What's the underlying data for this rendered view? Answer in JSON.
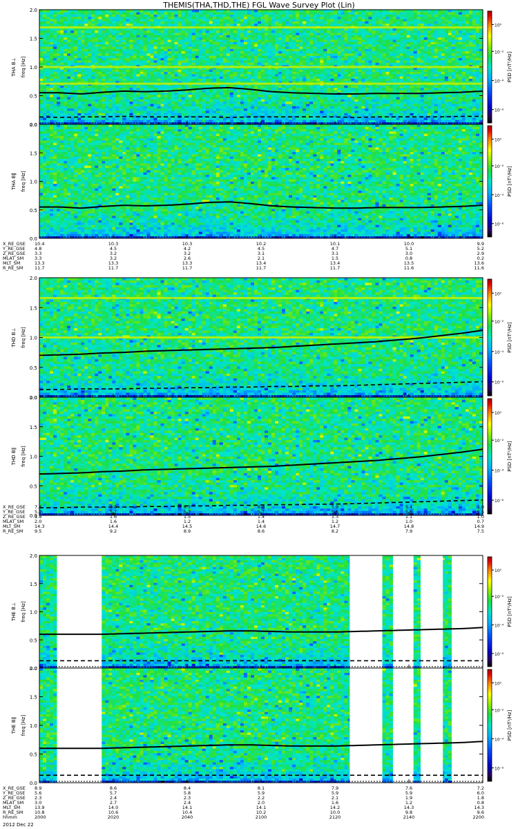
{
  "title": "THEMIS(THA,THD,THE) FGL Wave Survey Plot (Lin)",
  "date_label": "2012 Dec 22",
  "colorbar_label": "PSD [nT²/Hz]",
  "colorbar_ticks": [
    "10⁰",
    "10⁻²",
    "10⁻⁴",
    "10⁻⁶"
  ],
  "ytick_labels": [
    "2.0",
    "1.5",
    "1.0",
    "0.5",
    "0.0"
  ],
  "ephem_labels": [
    "X_RE_GSE",
    "Y_RE_GSE",
    "Z_RE_GSE",
    "MLAT_SM",
    "MLT_SM",
    "R_RE_SM"
  ],
  "ephem_labels_last": [
    "X_RE_GSE",
    "Y_RE_GSE",
    "Z_RE_GSE",
    "MLAT_SM",
    "MLT_SM",
    "R_RE_SM",
    "hhmm"
  ],
  "ephem": {
    "tha": [
      [
        "10.4",
        "10.3",
        "10.3",
        "10.2",
        "10.1",
        "10.0",
        "9.9"
      ],
      [
        "4.8",
        "4.5",
        "4.2",
        "4.5",
        "4.7",
        "5.1",
        "5.2"
      ],
      [
        "3.3",
        "3.2",
        "3.2",
        "3.1",
        "3.1",
        "3.0",
        "2.9"
      ],
      [
        "3.3",
        "3.2",
        "2.6",
        "2.1",
        "1.5",
        "0.8",
        "0.2"
      ],
      [
        "13.3",
        "13.3",
        "13.3",
        "13.4",
        "13.4",
        "13.5",
        "13.6"
      ],
      [
        "11.7",
        "11.7",
        "11.7",
        "11.7",
        "11.7",
        "11.6",
        "11.6"
      ]
    ],
    "thd": [
      [
        "7.4",
        "7.0",
        "6.7",
        "6.3",
        "5.9",
        "5.4",
        "5.0"
      ],
      [
        "5.7",
        "5.7",
        "5.7",
        "5.7",
        "5.6",
        "5.6",
        "5.5"
      ],
      [
        "1.8",
        "1.6",
        "1.5",
        "1.4",
        "1.3",
        "1.1",
        "1.0"
      ],
      [
        "2.0",
        "1.6",
        "1.2",
        "1.4",
        "1.2",
        "1.0",
        "0.7"
      ],
      [
        "14.3",
        "14.4",
        "14.5",
        "14.6",
        "14.7",
        "14.8",
        "14.9"
      ],
      [
        "9.5",
        "9.2",
        "8.9",
        "8.6",
        "8.2",
        "7.9",
        "7.5"
      ]
    ],
    "the": [
      [
        "8.9",
        "8.6",
        "8.4",
        "8.1",
        "7.9",
        "7.6",
        "7.2"
      ],
      [
        "5.6",
        "5.7",
        "5.8",
        "5.9",
        "5.9",
        "5.9",
        "6.0"
      ],
      [
        "2.3",
        "2.4",
        "2.3",
        "2.2",
        "2.1",
        "1.9",
        "1.8"
      ],
      [
        "3.0",
        "2.7",
        "2.4",
        "2.0",
        "1.6",
        "1.2",
        "0.8"
      ],
      [
        "13.9",
        "14.0",
        "14.1",
        "14.1",
        "14.2",
        "14.3",
        "14.3"
      ],
      [
        "10.8",
        "10.6",
        "10.4",
        "10.2",
        "10.0",
        "9.8",
        "9.6"
      ],
      [
        "2000",
        "2020",
        "2040",
        "2100",
        "2120",
        "2140",
        "2200"
      ]
    ]
  },
  "colors": {
    "background": "#ffffff",
    "axis": "#000000",
    "gap": "#ffffff"
  },
  "chart_data": {
    "type": "heatmap",
    "title": "THEMIS(THA,THD,THE) FGL Wave Survey Plot (Lin)",
    "xlabel": "hhmm",
    "x_ticks": [
      "2000",
      "2020",
      "2040",
      "2100",
      "2120",
      "2140",
      "2200"
    ],
    "ylim": [
      0,
      2.0
    ],
    "colorbar": {
      "label": "PSD [nT²/Hz]",
      "scale": "log",
      "range": [
        1e-06,
        10.0
      ],
      "colormap": "rainbow"
    },
    "grid": false,
    "panels": [
      {
        "label": "THA B⊥",
        "ylabel": "freq [Hz]",
        "line_solid": [
          0.55,
          0.55,
          0.53,
          0.56,
          0.58,
          0.57,
          0.58,
          0.6,
          0.63,
          0.64,
          0.61,
          0.57,
          0.55,
          0.54,
          0.53,
          0.53,
          0.54,
          0.54,
          0.54,
          0.55,
          0.56,
          0.58
        ],
        "line_dashed": [
          0.13,
          0.12,
          0.13,
          0.13,
          0.14,
          0.13,
          0.13,
          0.13,
          0.13,
          0.12,
          0.13,
          0.13,
          0.13,
          0.13,
          0.13,
          0.12,
          0.13,
          0.13,
          0.13,
          0.13,
          0.14,
          0.14
        ],
        "bands": [
          1.69,
          1.0,
          0.71
        ],
        "gaps": []
      },
      {
        "label": "THA B∥",
        "ylabel": "freq [Hz]",
        "line_solid": [
          0.55,
          0.55,
          0.53,
          0.56,
          0.58,
          0.57,
          0.58,
          0.6,
          0.63,
          0.64,
          0.61,
          0.57,
          0.55,
          0.54,
          0.53,
          0.53,
          0.54,
          0.54,
          0.54,
          0.55,
          0.56,
          0.58
        ],
        "line_dashed": [],
        "bands": [],
        "gaps": []
      },
      {
        "label": "THD B⊥",
        "ylabel": "freq [Hz]",
        "line_solid": [
          0.7,
          0.71,
          0.72,
          0.74,
          0.75,
          0.77,
          0.78,
          0.79,
          0.8,
          0.81,
          0.82,
          0.83,
          0.85,
          0.87,
          0.89,
          0.91,
          0.93,
          0.96,
          0.99,
          1.03,
          1.07,
          1.12
        ],
        "line_dashed": [
          0.13,
          0.13,
          0.14,
          0.14,
          0.14,
          0.15,
          0.15,
          0.16,
          0.16,
          0.17,
          0.17,
          0.18,
          0.18,
          0.19,
          0.19,
          0.2,
          0.21,
          0.22,
          0.23,
          0.24,
          0.25,
          0.26
        ],
        "bands": [
          1.66,
          1.0
        ],
        "gaps": []
      },
      {
        "label": "THD B∥",
        "ylabel": "freq [Hz]",
        "line_solid": [
          0.7,
          0.71,
          0.72,
          0.74,
          0.75,
          0.77,
          0.78,
          0.79,
          0.8,
          0.81,
          0.82,
          0.83,
          0.85,
          0.87,
          0.89,
          0.91,
          0.93,
          0.96,
          0.99,
          1.03,
          1.07,
          1.12
        ],
        "line_dashed": [
          0.13,
          0.13,
          0.14,
          0.14,
          0.14,
          0.15,
          0.15,
          0.16,
          0.16,
          0.17,
          0.17,
          0.18,
          0.18,
          0.19,
          0.19,
          0.2,
          0.21,
          0.22,
          0.23,
          0.24,
          0.25,
          0.26
        ],
        "bands": [],
        "gaps": []
      },
      {
        "label": "THE B⊥",
        "ylabel": "freq [Hz]",
        "line_solid": [
          0.6,
          0.6,
          0.6,
          0.6,
          0.61,
          0.62,
          0.63,
          0.64,
          0.65,
          0.66,
          0.66,
          0.65,
          0.64,
          0.64,
          0.64,
          0.65,
          0.66,
          0.67,
          0.68,
          0.69,
          0.7,
          0.72
        ],
        "line_dashed": [
          0.13,
          0.13,
          0.13,
          0.13,
          0.13,
          0.13,
          0.13,
          0.13,
          0.13,
          0.13,
          0.13,
          0.13,
          0.13,
          0.13,
          0.13,
          0.13,
          0.13,
          0.13,
          0.13,
          0.13,
          0.13,
          0.13
        ],
        "bands": [],
        "gaps": [
          [
            0.04,
            0.14
          ],
          [
            0.7,
            0.77
          ],
          [
            0.8,
            0.84
          ],
          [
            0.86,
            0.91
          ],
          [
            0.93,
            1.01
          ]
        ]
      },
      {
        "label": "THE B∥",
        "ylabel": "freq [Hz]",
        "line_solid": [
          0.6,
          0.6,
          0.6,
          0.6,
          0.61,
          0.62,
          0.63,
          0.64,
          0.65,
          0.66,
          0.66,
          0.65,
          0.64,
          0.64,
          0.64,
          0.65,
          0.66,
          0.67,
          0.68,
          0.69,
          0.7,
          0.72
        ],
        "line_dashed": [
          0.13,
          0.13,
          0.13,
          0.13,
          0.13,
          0.13,
          0.13,
          0.13,
          0.13,
          0.13,
          0.13,
          0.13,
          0.13,
          0.13,
          0.13,
          0.13,
          0.13,
          0.13,
          0.13,
          0.13,
          0.13,
          0.13
        ],
        "bands": [],
        "gaps": [
          [
            0.04,
            0.14
          ],
          [
            0.7,
            0.77
          ],
          [
            0.8,
            0.84
          ],
          [
            0.86,
            0.91
          ],
          [
            0.93,
            1.01
          ]
        ]
      }
    ]
  }
}
